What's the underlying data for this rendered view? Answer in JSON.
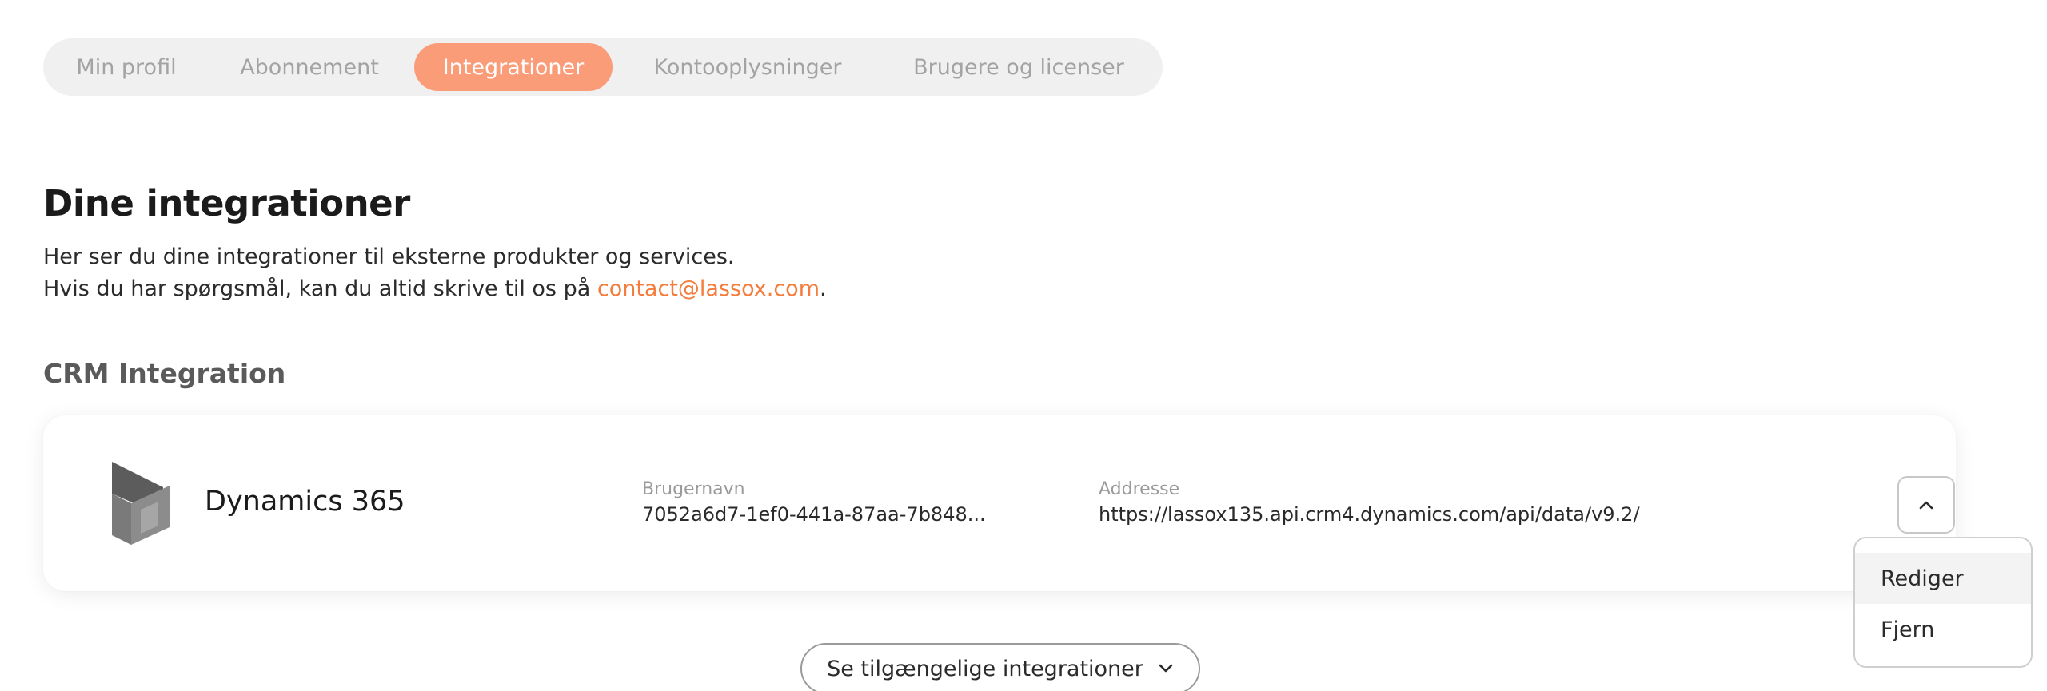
{
  "tabs": {
    "items": [
      {
        "label": "Min profil"
      },
      {
        "label": "Abonnement"
      },
      {
        "label": "Integrationer"
      },
      {
        "label": "Kontooplysninger"
      },
      {
        "label": "Brugere og licenser"
      }
    ],
    "active": "Integrationer"
  },
  "page": {
    "title": "Dine integrationer",
    "line1": "Her ser du dine integrationer til eksterne produkter og services.",
    "line2_prefix": "Hvis du har spørgsmål, kan du altid skrive til os på ",
    "email": "contact@lassox.com",
    "line2_suffix": "."
  },
  "crm": {
    "section_title": "CRM Integration",
    "integration": {
      "name": "Dynamics 365",
      "icon": "dynamics-365-logo",
      "username_label": "Brugernavn",
      "username_value": "7052a6d7-1ef0-441a-87aa-7b848...",
      "address_label": "Addresse",
      "address_value": "https://lassox135.api.crm4.dynamics.com/api/data/v9.2/"
    },
    "menu": {
      "items": [
        {
          "label": "Rediger"
        },
        {
          "label": "Fjern"
        }
      ]
    }
  },
  "footer": {
    "available_button": "Se tilgængelige integrationer"
  },
  "colors": {
    "accent": "#fb9c79",
    "link": "#f47c3c"
  }
}
